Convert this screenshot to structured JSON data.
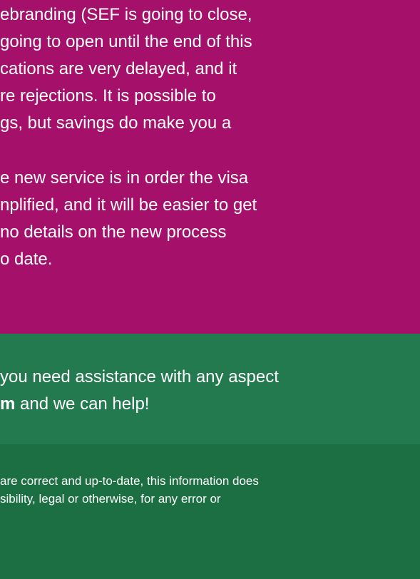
{
  "colors": {
    "magenta_section": "#a4106a",
    "green_section": "#247a4f",
    "disclaimer_section": "#1c6e43",
    "text": "#ffffff"
  },
  "article": {
    "paragraph1": [
      "ebranding (SEF is going to close,",
      "going to open until the end of this",
      "cations are very delayed, and it",
      "re rejections. It is possible to",
      "gs, but savings do make you a"
    ],
    "paragraph2": [
      "e new service is in order the visa",
      "nplified, and it will be easier to get",
      "no details on the new process",
      "o date."
    ]
  },
  "assistance": {
    "line1": "you need assistance with any aspect",
    "line2_bold": "m",
    "line2_rest": " and we can help!"
  },
  "disclaimer": {
    "line1": "are correct and up-to-date, this information does",
    "line2": "sibility, legal or otherwise, for any error or"
  }
}
